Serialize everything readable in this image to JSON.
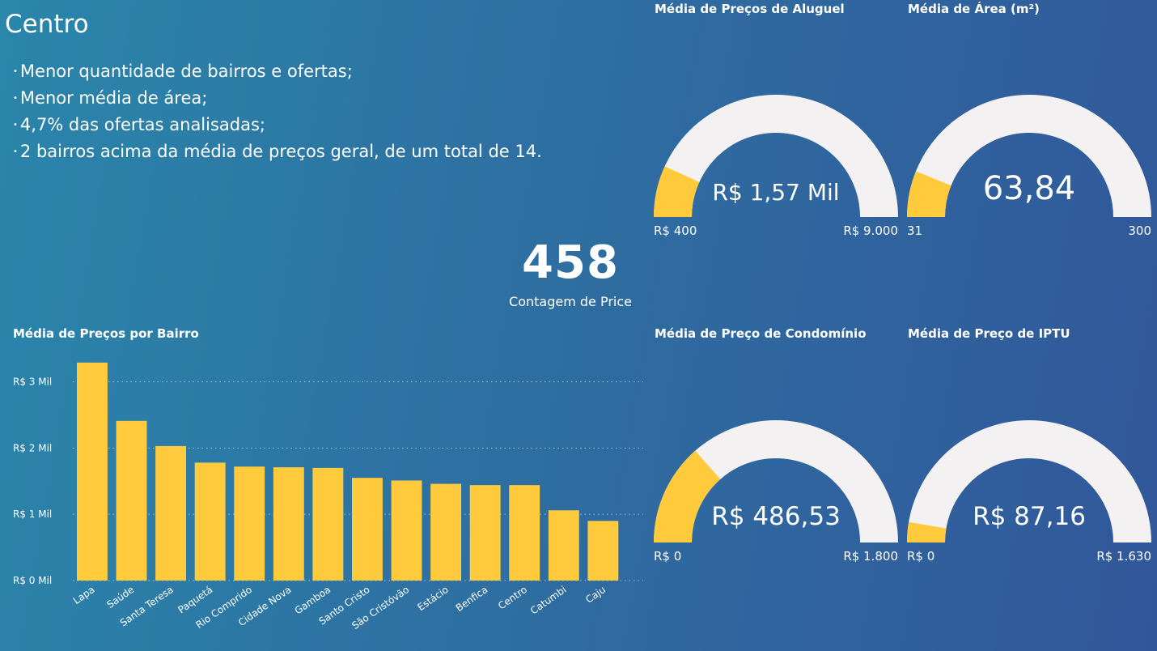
{
  "header": {
    "title": "Centro"
  },
  "bullets": [
    "Menor quantidade de bairros e ofertas;",
    "Menor média de área;",
    "4,7% das ofertas analisadas;",
    "2 bairros acima da média de preços geral, de um total de 14."
  ],
  "kpi": {
    "value": "458",
    "label": "Contagem de Price"
  },
  "colors": {
    "accent": "#ffcb3d",
    "track": "#f3f1f1",
    "grid": "#9fc3d8"
  },
  "gauges": [
    {
      "title": "Média de Preços de Aluguel",
      "value_label": "R$ 1,57 Mil",
      "value": 1570,
      "min": 400,
      "max": 9000,
      "min_label": "R$ 400",
      "max_label": "R$ 9.000"
    },
    {
      "title": "Média de Área (m²)",
      "value_label": "63,84",
      "value": 63.84,
      "min": 31,
      "max": 300,
      "min_label": "31",
      "max_label": "300"
    },
    {
      "title": "Média de Preço de Condomínio",
      "value_label": "R$ 486,53",
      "value": 486.53,
      "min": 0,
      "max": 1800,
      "min_label": "R$ 0",
      "max_label": "R$ 1.800"
    },
    {
      "title": "Média de Preço de IPTU",
      "value_label": "R$ 87,16",
      "value": 87.16,
      "min": 0,
      "max": 1630,
      "min_label": "R$ 0",
      "max_label": "R$ 1.630"
    }
  ],
  "chart_data": {
    "type": "bar",
    "title": "Média de Preços por Bairro",
    "categories": [
      "Lapa",
      "Saúde",
      "Santa Teresa",
      "Paquetá",
      "Rio Comprido",
      "Cidade Nova",
      "Gamboa",
      "Santo Cristo",
      "São Cristóvão",
      "Estácio",
      "Benfica",
      "Centro",
      "Catumbi",
      "Caju"
    ],
    "values": [
      3290,
      2410,
      2030,
      1780,
      1720,
      1710,
      1700,
      1550,
      1510,
      1460,
      1440,
      1440,
      1060,
      900
    ],
    "yticks": [
      0,
      1000,
      2000,
      3000
    ],
    "ytick_labels": [
      "R$ 0 Mil",
      "R$ 1 Mil",
      "R$ 2 Mil",
      "R$ 3 Mil"
    ],
    "ylim": [
      0,
      3300
    ],
    "grid": true,
    "color": "#ffcb3d"
  }
}
